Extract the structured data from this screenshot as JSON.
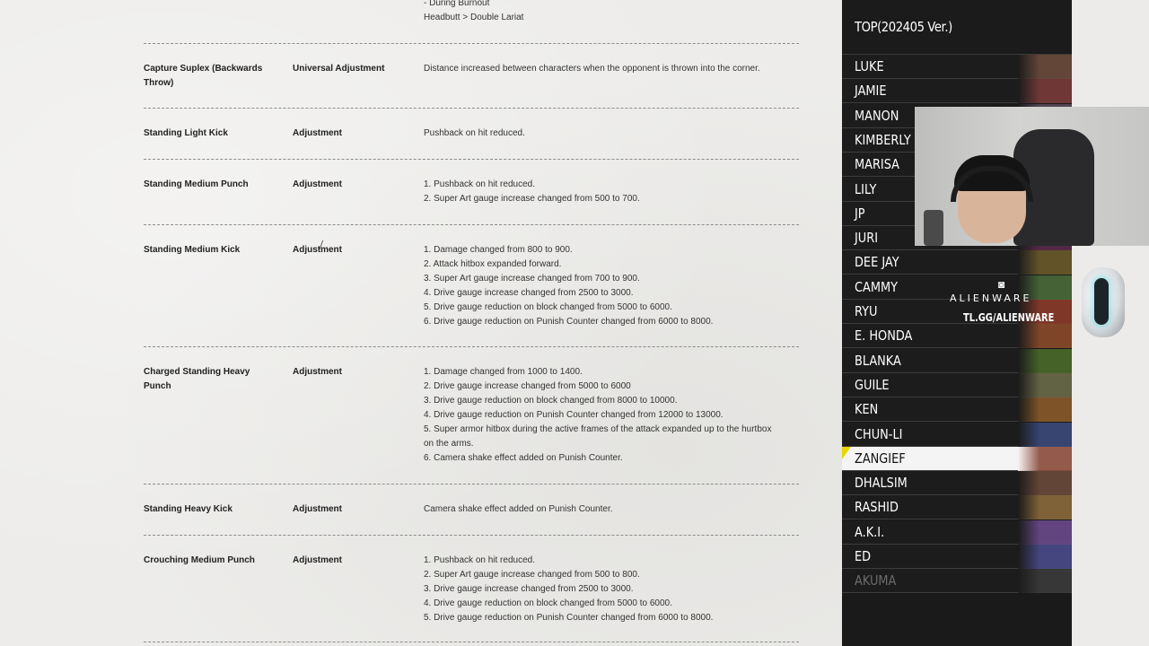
{
  "notes": {
    "top_lines": [
      "- During Burnout",
      "Headbutt > Double Lariat"
    ],
    "entries": [
      {
        "move": "Capture Suplex (Backwards Throw)",
        "type": "Universal Adjustment",
        "details": [
          "Distance increased between characters when the opponent is thrown into the corner."
        ]
      },
      {
        "move": "Standing Light Kick",
        "type": "Adjustment",
        "details": [
          "Pushback on hit reduced."
        ]
      },
      {
        "move": "Standing Medium Punch",
        "type": "Adjustment",
        "details": [
          "1. Pushback on hit reduced.",
          "2. Super Art gauge increase changed from 500 to 700."
        ]
      },
      {
        "move": "Standing Medium Kick",
        "type": "Adjustment",
        "details": [
          "1. Damage changed from 800 to 900.",
          "2. Attack hitbox expanded forward.",
          "3. Super Art gauge increase changed from 700 to 900.",
          "4. Drive gauge increase changed from 2500 to 3000.",
          "5. Drive gauge reduction on block changed from 5000 to 6000.",
          "6. Drive gauge reduction on Punish Counter changed from 6000 to 8000."
        ]
      },
      {
        "move": "Charged Standing Heavy Punch",
        "type": "Adjustment",
        "details": [
          "1. Damage changed from 1000 to 1400.",
          "2. Drive gauge increase changed from 5000 to 6000",
          "3. Drive gauge reduction on block changed from 8000 to 10000.",
          "4. Drive gauge reduction on Punish Counter changed from 12000 to 13000.",
          "5. Super armor hitbox during the active frames of the attack expanded up to the hurtbox on the arms.",
          "6. Camera shake effect added on Punish Counter."
        ]
      },
      {
        "move": "Standing Heavy Kick",
        "type": "Adjustment",
        "details": [
          "Camera shake effect added on Punish Counter."
        ]
      },
      {
        "move": "Crouching Medium Punch",
        "type": "Adjustment",
        "details": [
          "1. Pushback on hit reduced.",
          "2. Super Art gauge increase changed from 500 to 800.",
          "3. Drive gauge increase changed from 2500 to 3000.",
          "4. Drive gauge reduction on block changed from 5000 to 6000.",
          "5. Drive gauge reduction on Punish Counter changed from 6000 to 8000."
        ]
      }
    ]
  },
  "roster": {
    "title": "TOP(202405 Ver.)",
    "characters": [
      {
        "name": "LUKE",
        "color": "#6b4b3c"
      },
      {
        "name": "JAMIE",
        "color": "#7a3a3a"
      },
      {
        "name": "MANON",
        "color": "#5a4a5a"
      },
      {
        "name": "KIMBERLY",
        "color": "#6a3c5a"
      },
      {
        "name": "MARISA",
        "color": "#7a5a3a"
      },
      {
        "name": "LILY",
        "color": "#5a6a7a"
      },
      {
        "name": "JP",
        "color": "#4a4a5a"
      },
      {
        "name": "JURI",
        "color": "#5a2a4a"
      },
      {
        "name": "DEE JAY",
        "color": "#6a5a2a"
      },
      {
        "name": "CAMMY",
        "color": "#4a6a3a"
      },
      {
        "name": "RYU",
        "color": "#8a3a2a"
      },
      {
        "name": "E. HONDA",
        "color": "#8a4a2a"
      },
      {
        "name": "BLANKA",
        "color": "#4a6a2a"
      },
      {
        "name": "GUILE",
        "color": "#6a6a4a"
      },
      {
        "name": "KEN",
        "color": "#8a5a2a"
      },
      {
        "name": "CHUN-LI",
        "color": "#3a4a7a"
      },
      {
        "name": "ZANGIEF",
        "color": "#8a4a3a",
        "selected": true
      },
      {
        "name": "DHALSIM",
        "color": "#6a4a3a"
      },
      {
        "name": "RASHID",
        "color": "#8a6a3a"
      },
      {
        "name": "A.K.I.",
        "color": "#6a4a8a"
      },
      {
        "name": "ED",
        "color": "#4a4a8a"
      },
      {
        "name": "AKUMA",
        "color": "#3a3a3a",
        "dim": true
      }
    ]
  },
  "sponsor": {
    "icon": "alien-head-icon",
    "brand": "ALIENWARE",
    "url": "TL.GG/ALIENWARE"
  }
}
